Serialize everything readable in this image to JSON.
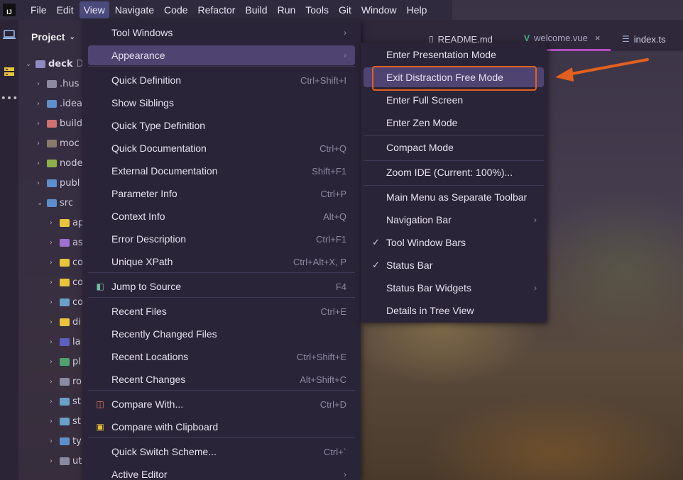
{
  "menubar": {
    "logo": "IJ",
    "items": [
      "File",
      "Edit",
      "View",
      "Navigate",
      "Code",
      "Refactor",
      "Build",
      "Run",
      "Tools",
      "Git",
      "Window",
      "Help"
    ]
  },
  "project_panel": {
    "title": "Project",
    "root": "deck",
    "root_suffix": "D",
    "items": [
      ".hus",
      ".idea",
      "build",
      "moc",
      "node",
      "publ",
      "src",
      "ap",
      "as",
      "co",
      "co",
      "co",
      "di",
      "la",
      "pl",
      "ro",
      "st",
      "st",
      "ty",
      "ut"
    ]
  },
  "tabs": [
    {
      "label": "README.md",
      "icon": "file-icon"
    },
    {
      "label": "welcome.vue",
      "icon": "vue-icon",
      "close": "×"
    },
    {
      "label": "index.ts",
      "icon": "ts-icon"
    }
  ],
  "view_menu": {
    "items": [
      {
        "label": "Tool Windows",
        "shortcut": "",
        "submenu": "›"
      },
      {
        "label": "Appearance",
        "shortcut": "",
        "submenu": "›"
      },
      {
        "label": "Quick Definition",
        "shortcut": "Ctrl+Shift+I"
      },
      {
        "label": "Show Siblings",
        "shortcut": ""
      },
      {
        "label": "Quick Type Definition",
        "shortcut": ""
      },
      {
        "label": "Quick Documentation",
        "shortcut": "Ctrl+Q"
      },
      {
        "label": "External Documentation",
        "shortcut": "Shift+F1"
      },
      {
        "label": "Parameter Info",
        "shortcut": "Ctrl+P"
      },
      {
        "label": "Context Info",
        "shortcut": "Alt+Q"
      },
      {
        "label": "Error Description",
        "shortcut": "Ctrl+F1"
      },
      {
        "label": "Unique XPath",
        "shortcut": "Ctrl+Alt+X, P"
      },
      {
        "label": "Jump to Source",
        "shortcut": "F4"
      },
      {
        "label": "Recent Files",
        "shortcut": "Ctrl+E"
      },
      {
        "label": "Recently Changed Files",
        "shortcut": ""
      },
      {
        "label": "Recent Locations",
        "shortcut": "Ctrl+Shift+E"
      },
      {
        "label": "Recent Changes",
        "shortcut": "Alt+Shift+C"
      },
      {
        "label": "Compare With...",
        "shortcut": "Ctrl+D"
      },
      {
        "label": "Compare with Clipboard",
        "shortcut": ""
      },
      {
        "label": "Quick Switch Scheme...",
        "shortcut": "Ctrl+`"
      },
      {
        "label": "Active Editor",
        "shortcut": "",
        "submenu": "›"
      }
    ]
  },
  "appearance_menu": {
    "items": [
      {
        "label": "Enter Presentation Mode"
      },
      {
        "label": "Exit Distraction Free Mode"
      },
      {
        "label": "Enter Full Screen"
      },
      {
        "label": "Enter Zen Mode"
      },
      {
        "label": "Compact Mode"
      },
      {
        "label": "Zoom IDE (Current: 100%)..."
      },
      {
        "label": "Main Menu as Separate Toolbar"
      },
      {
        "label": "Navigation Bar",
        "submenu": "›"
      },
      {
        "label": "Tool Window Bars",
        "check": "✓"
      },
      {
        "label": "Status Bar",
        "check": "✓"
      },
      {
        "label": "Status Bar Widgets",
        "submenu": "›"
      },
      {
        "label": "Details in Tree View"
      }
    ]
  },
  "colors": {
    "highlight": "#4f4371",
    "annotation": "#e2601e",
    "active_tab_border": "#b24ec0"
  }
}
